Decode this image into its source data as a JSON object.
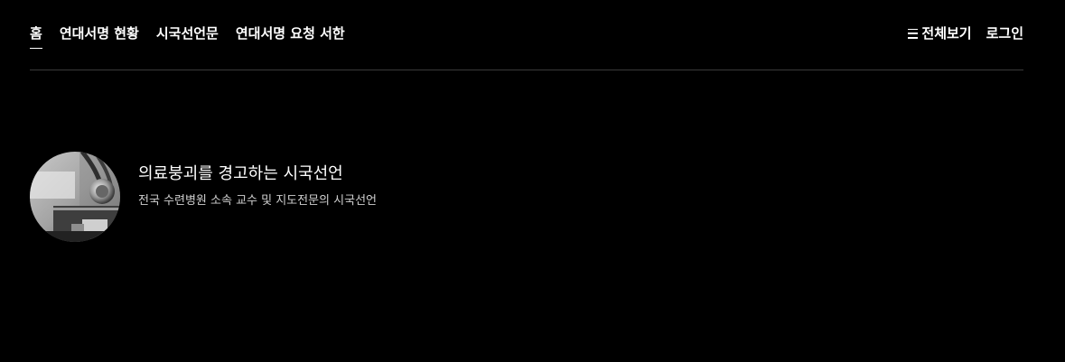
{
  "nav": {
    "items": [
      {
        "label": "홈",
        "active": true
      },
      {
        "label": "연대서명 현황",
        "active": false
      },
      {
        "label": "시국선언문",
        "active": false
      },
      {
        "label": "연대서명 요청 서한",
        "active": false
      }
    ],
    "menu_all_label": "전체보기",
    "menu_all_icon": "hamburger-icon",
    "login_label": "로그인"
  },
  "feature": {
    "title": "의료붕괴를 경고하는 시국선언",
    "subtitle": "전국 수련병원 소속 교수 및 지도전문의 시국선언",
    "thumbnail_icon": "stethoscope-photo"
  },
  "colors": {
    "background": "#000000",
    "text": "#ffffff",
    "subtext": "#d0d0d0",
    "divider": "#3a3a3a"
  }
}
